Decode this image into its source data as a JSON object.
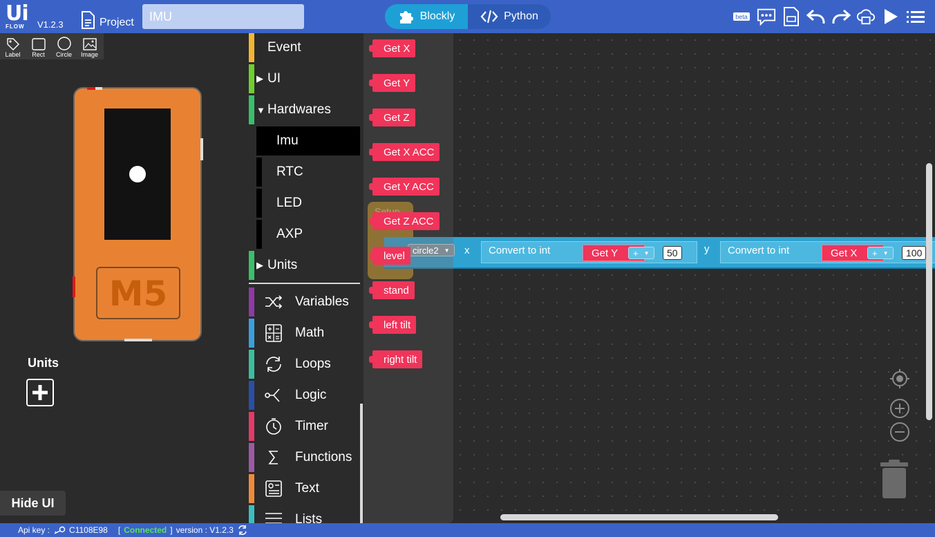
{
  "app": {
    "logo_top": "Ui",
    "logo_bottom": "FLOW",
    "version": "V1.2.3"
  },
  "toolbar": {
    "project_label": "Project",
    "project_name": "IMU",
    "mode_blockly": "Blockly",
    "mode_python": "Python",
    "icons": [
      "beta-icon",
      "chat-icon",
      "document-icon",
      "undo-icon",
      "redo-icon",
      "cloud-upload-icon",
      "run-icon",
      "menu-icon"
    ],
    "beta_label": "beta"
  },
  "ui_panel": {
    "shape_tools": [
      {
        "label": "Label",
        "icon": "tag-icon"
      },
      {
        "label": "Rect",
        "icon": "rect-icon"
      },
      {
        "label": "Circle",
        "icon": "circle-icon"
      },
      {
        "label": "Image",
        "icon": "image-icon"
      }
    ],
    "device_brand": "M5",
    "units_title": "Units",
    "hide_ui": "Hide UI"
  },
  "categories": {
    "event": "Event",
    "ui": "UI",
    "hardwares": "Hardwares",
    "hardware_items": [
      "Imu",
      "RTC",
      "LED",
      "AXP"
    ],
    "selected_hardware": "Imu",
    "units": "Units",
    "items": [
      {
        "label": "Variables",
        "color": "#8e3aa4",
        "icon": "shuffle-icon"
      },
      {
        "label": "Math",
        "color": "#3aa0dc",
        "icon": "calculator-icon"
      },
      {
        "label": "Loops",
        "color": "#3bbf9e",
        "icon": "loop-icon"
      },
      {
        "label": "Logic",
        "color": "#2a4fa8",
        "icon": "branch-icon"
      },
      {
        "label": "Timer",
        "color": "#e23a6a",
        "icon": "timer-icon"
      },
      {
        "label": "Functions",
        "color": "#9c5aa4",
        "icon": "sigma-icon"
      },
      {
        "label": "Text",
        "color": "#f08a3a",
        "icon": "text-icon"
      },
      {
        "label": "Lists",
        "color": "#3bbfbf",
        "icon": "list-icon"
      }
    ],
    "colors": {
      "event": "#f2b632",
      "ui": "#6fcf2e",
      "hardwares": "#3bbf6a",
      "units": "#3bbf6a"
    }
  },
  "flyout": {
    "blocks": [
      "Get X",
      "Get Y",
      "Get Z",
      "Get X ACC",
      "Get Y ACC",
      "Get Z ACC",
      "level",
      "stand",
      "left tilt",
      "right tilt"
    ]
  },
  "workspace": {
    "setup_label": "Setup",
    "target": "circle2",
    "x_label": "x",
    "y_label": "y",
    "convert_label": "Convert to int",
    "get_y": "Get Y",
    "get_x": "Get X",
    "op": "+",
    "val_x": "50",
    "val_y": "100"
  },
  "status": {
    "api_key_label": "Api key :",
    "api_key": "C1108E98",
    "bracket_open": "[",
    "connection": "Connected",
    "bracket_close": "]",
    "version_label": "version : V1.2.3"
  },
  "colors": {
    "topbar": "#3b63c7",
    "blockly_active": "#1ea0d6",
    "block_red": "#f0345a",
    "block_blue": "#2ea3d2",
    "device_orange": "#e88232"
  }
}
